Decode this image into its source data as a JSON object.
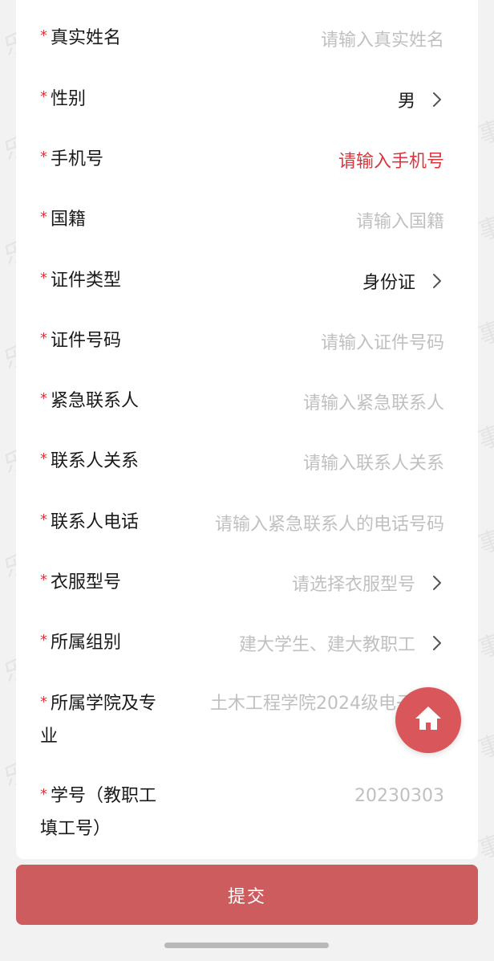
{
  "form": {
    "fields": [
      {
        "label": "真实姓名",
        "value": "请输入真实姓名",
        "state": "placeholder",
        "chevron": false
      },
      {
        "label": "性别",
        "value": "男",
        "state": "filled",
        "chevron": true
      },
      {
        "label": "手机号",
        "value": "请输入手机号",
        "state": "error",
        "chevron": false
      },
      {
        "label": "国籍",
        "value": "请输入国籍",
        "state": "placeholder",
        "chevron": false
      },
      {
        "label": "证件类型",
        "value": "身份证",
        "state": "filled",
        "chevron": true
      },
      {
        "label": "证件号码",
        "value": "请输入证件号码",
        "state": "placeholder",
        "chevron": false
      },
      {
        "label": "紧急联系人",
        "value": "请输入紧急联系人",
        "state": "placeholder",
        "chevron": false
      },
      {
        "label": "联系人关系",
        "value": "请输入联系人关系",
        "state": "placeholder",
        "chevron": false
      },
      {
        "label": "联系人电话",
        "value": "请输入紧急联系人的电话号码",
        "state": "placeholder",
        "chevron": false
      },
      {
        "label": "衣服型号",
        "value": "请选择衣服型号",
        "state": "placeholder",
        "chevron": true
      },
      {
        "label": "所属组别",
        "value": "建大学生、建大教职工",
        "state": "placeholder",
        "chevron": true
      },
      {
        "label": "所属学院及专业",
        "value": "土木工程学院2024级电子",
        "state": "placeholder",
        "chevron": false
      },
      {
        "label": "学号（教职工填工号）",
        "value": "20230303",
        "state": "placeholder",
        "chevron": false
      }
    ],
    "required_mark": "*"
  },
  "submit_label": "提交",
  "watermark_text": [
    "乐",
    "事"
  ],
  "colors": {
    "required": "#d9363e",
    "error_text": "#d9363e",
    "placeholder": "#c0c0c0",
    "submit_bg": "#cd5c5e",
    "fab_bg": "#d9565a"
  },
  "fab_icon": "home-icon"
}
